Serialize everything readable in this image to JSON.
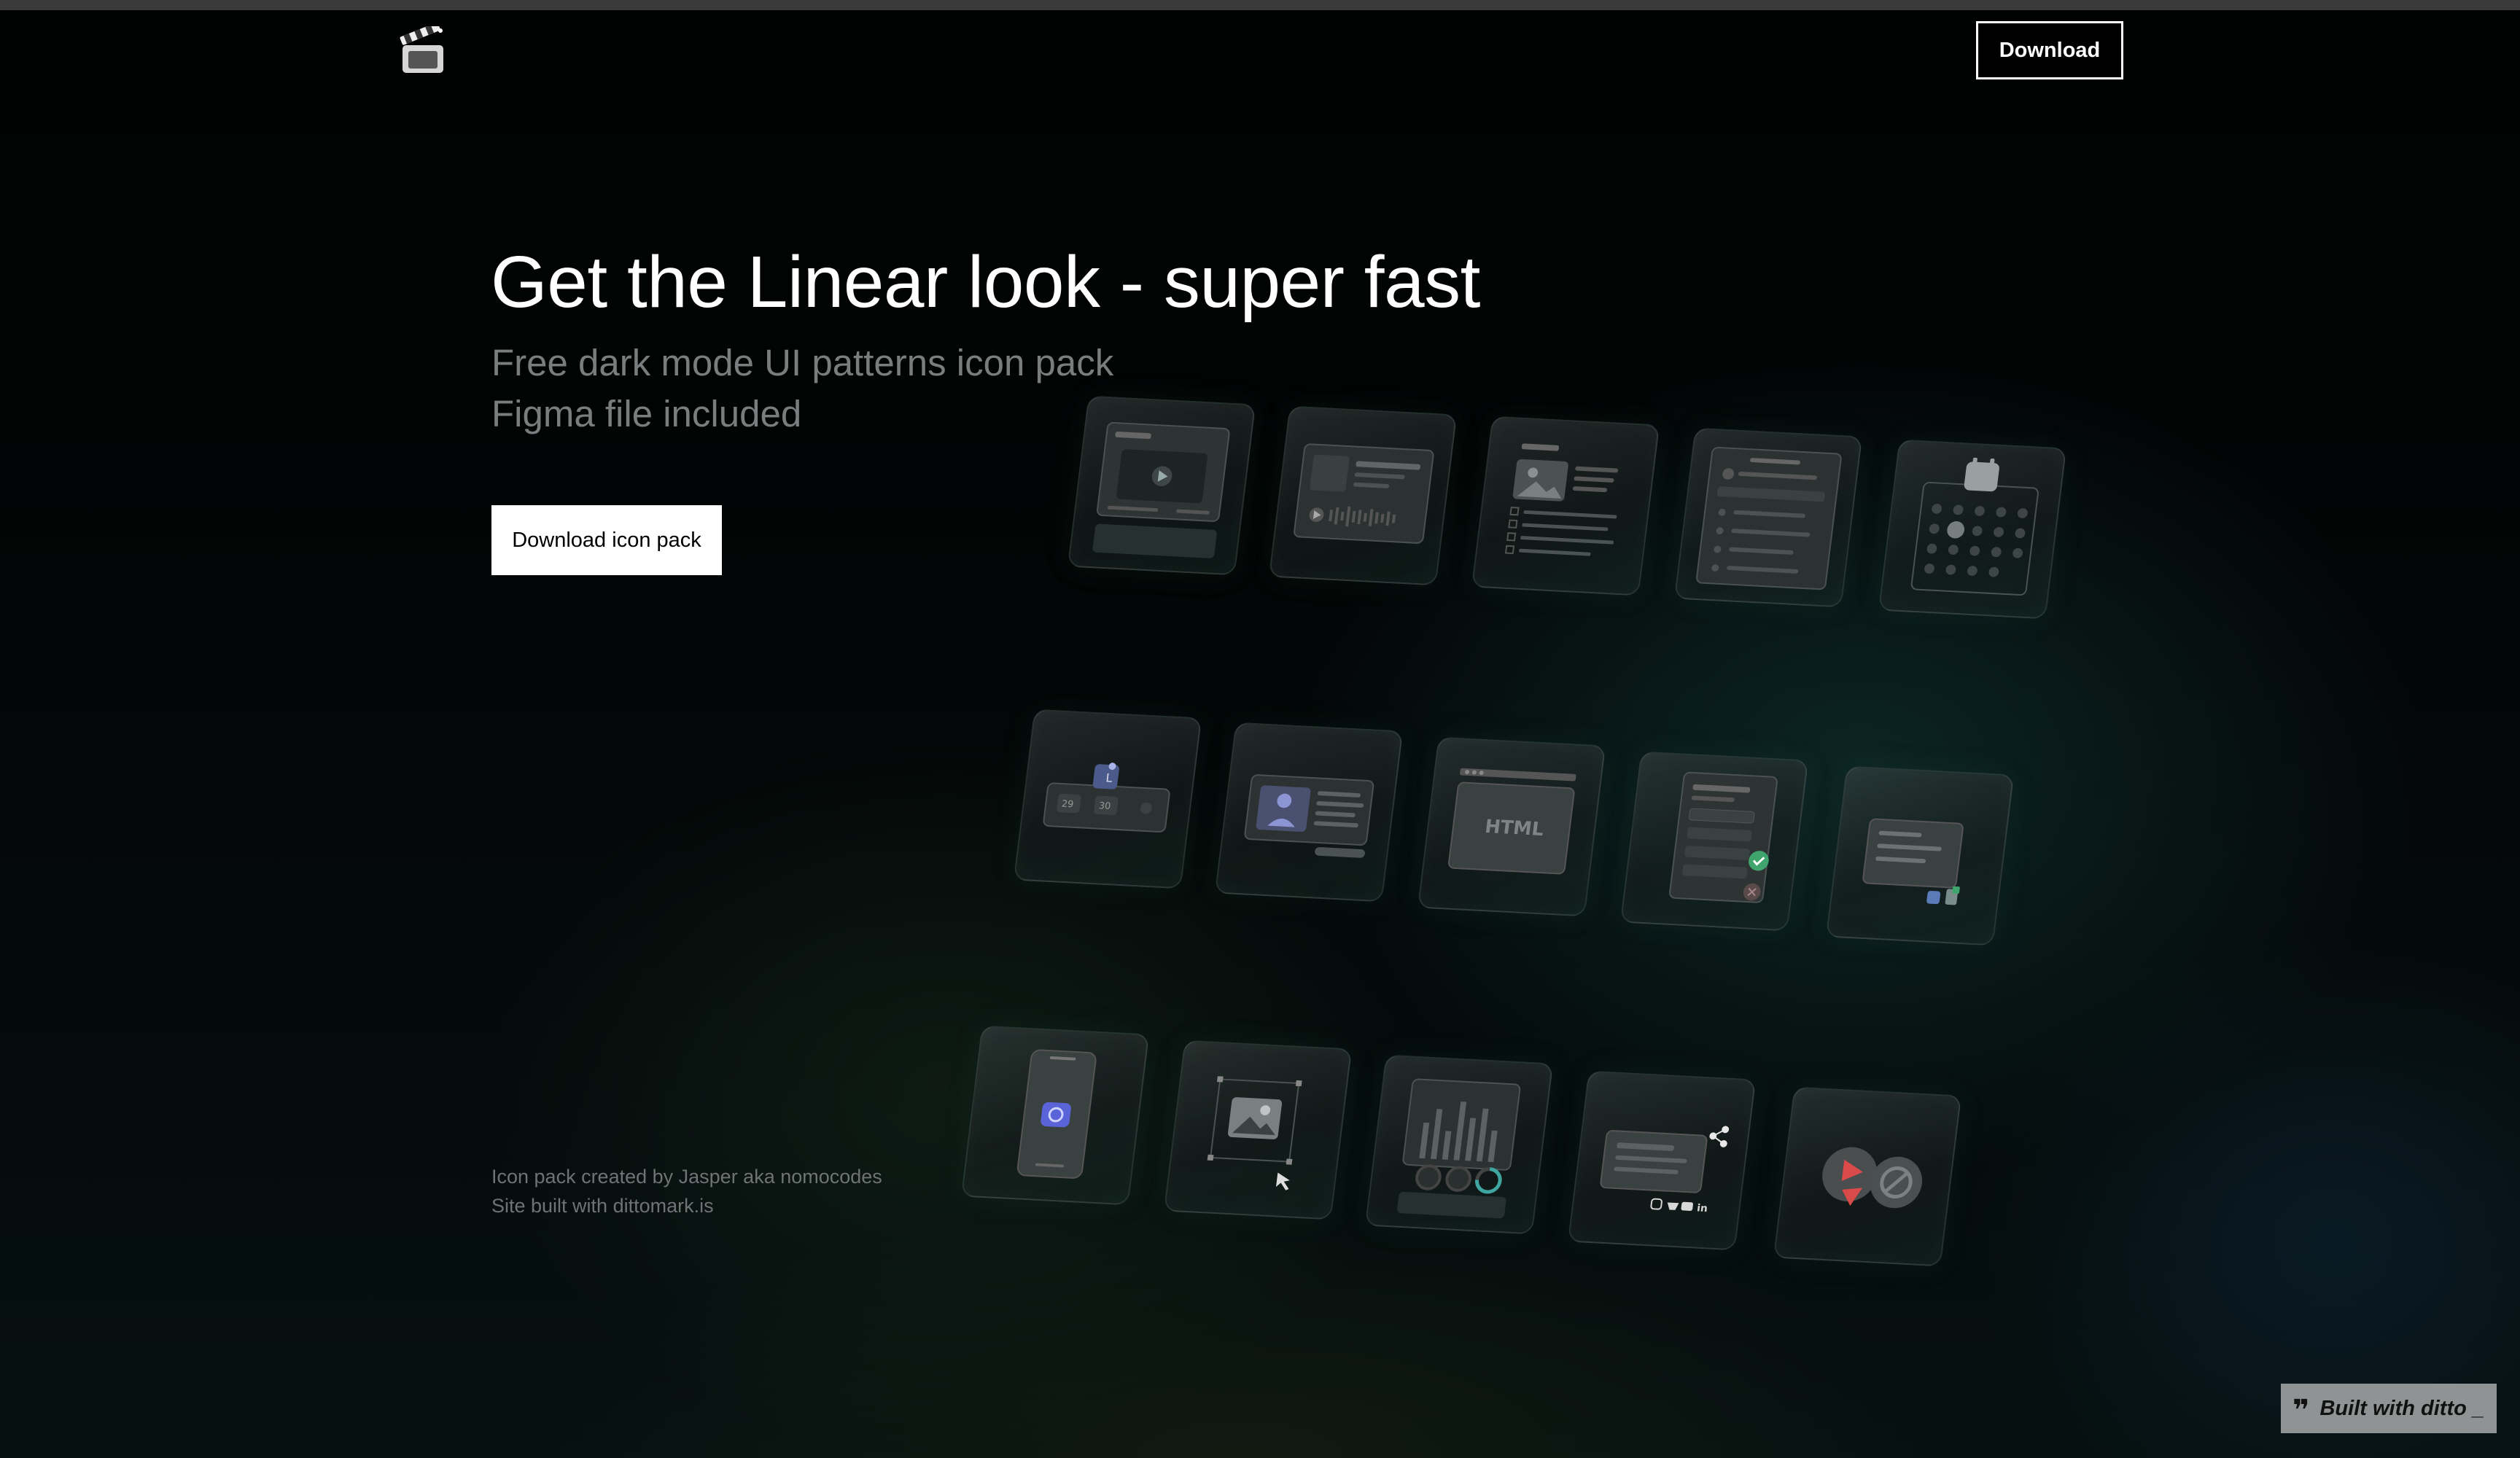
{
  "nav": {
    "logo_icon": "clapperboard-icon",
    "download_label": "Download"
  },
  "hero": {
    "title": "Get the Linear look - super fast",
    "subtitle_line1": "Free dark mode UI patterns icon pack",
    "subtitle_line2": "Figma file included",
    "cta_label": "Download icon pack"
  },
  "credits": {
    "line1": "Icon pack created by Jasper aka nomocodes",
    "line2": "Site built with dittomark.is"
  },
  "icon_cards": {
    "html_label": "HTML",
    "calendar_nums": [
      "29",
      "30"
    ],
    "social_text": "in"
  },
  "badge": {
    "label": "Built with ditto _",
    "icon": "quote-icon"
  },
  "colors": {
    "background": "#020303",
    "accent_green": "#3fa56d",
    "accent_red": "#d94a4a",
    "accent_blue": "#5a63d8"
  }
}
